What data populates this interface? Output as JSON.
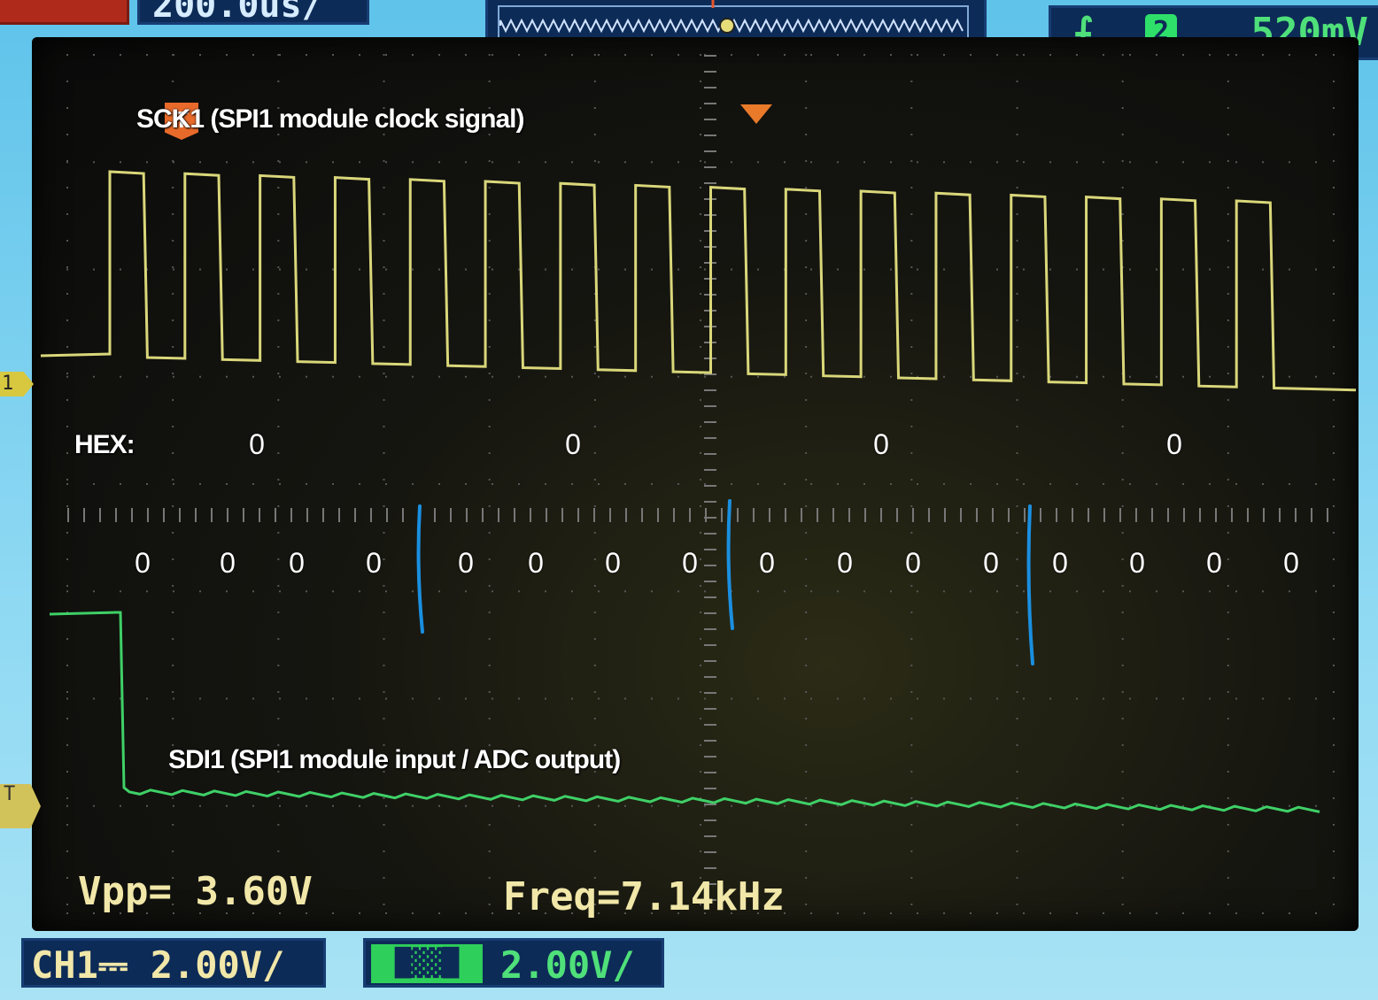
{
  "header": {
    "timebase": "200.0us/",
    "trigger": {
      "edge_icon": "rising-edge-icon",
      "source": "2",
      "level": "520mV"
    }
  },
  "screen": {
    "markers": {
      "trigger_t": "T",
      "ch1": "1",
      "ch2": "T"
    },
    "annotations": {
      "sck_label": "SCK1 (SPI1 module clock signal)",
      "sdi_label": "SDI1 (SPI1 module input / ADC output)",
      "hex_label": "HEX:",
      "hex_digits": [
        "0",
        "0",
        "0",
        "0"
      ],
      "bits": [
        "0",
        "0",
        "0",
        "0",
        "0",
        "0",
        "0",
        "0",
        "0",
        "0",
        "0",
        "0",
        "0",
        "0",
        "0",
        "0"
      ],
      "separator_color": "#1a8fe0"
    },
    "measurements": {
      "vpp": "Vpp= 3.60V",
      "freq": "Freq=7.14kHz"
    }
  },
  "channels": {
    "ch1": {
      "label": "CH1",
      "coupling_icon": "dc-coupling-icon",
      "scale": "2.00V/",
      "color": "#e6dc7a"
    },
    "ch2": {
      "scale": "2.00V/",
      "color": "#3fd067"
    }
  },
  "traces": {
    "ch1_clock_pulses": 16,
    "ch2_state": "high then low after start"
  }
}
